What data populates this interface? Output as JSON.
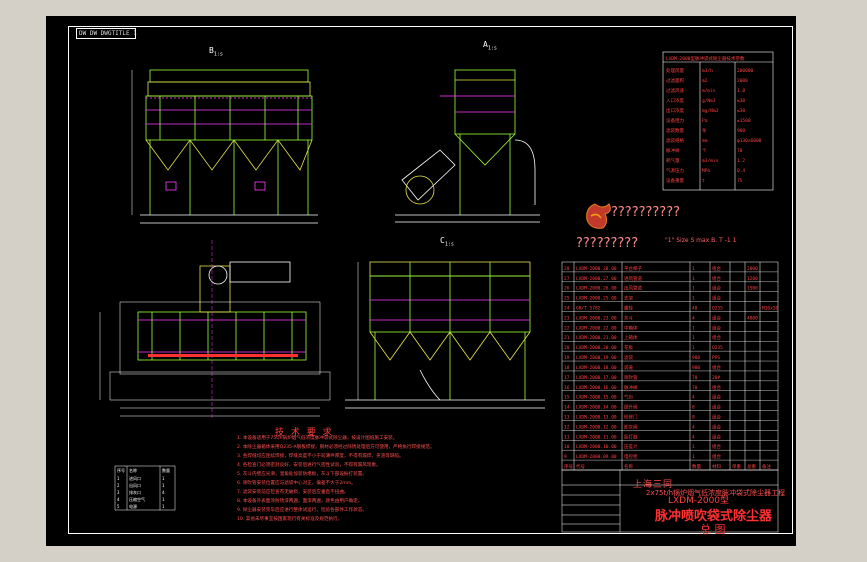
{
  "drawing": {
    "stamp": "DW DW DWGTITLE 1",
    "views": {
      "b_label": "B",
      "a_label": "A",
      "c_label": "C",
      "view_suffix": "1:s"
    },
    "logo_caption": "??????????",
    "subtitle": "?????????",
    "ratio_text": "\"1\" Size  S  max  B. T  -1  1",
    "title_block": {
      "project_name": "上海三同",
      "project_line2": "2x75t/h锅炉烟气低浓度脉冲袋式除尘器工程",
      "model": "LXDM-2000型",
      "main_title": "脉冲喷吹袋式除尘器",
      "drawing_name": "总  图"
    },
    "notes_title": "技 术 要 求",
    "notes": [
      "1. 本设备适用于75t/h锅炉烟气低浓度脉冲袋式除尘器，按设计图纸施工安装。",
      "2. 本除尘器箱体采用Q235-A钢板焊接，钢材必须经过除锈处理后方可使用，严格执行焊接规范。",
      "3. 各焊缝均应连续焊接，焊缝高度不小于较薄件厚度，不得有漏焊、夹渣等缺陷。",
      "4. 各检查门必须密封良好，安装后进行气密性试验，不得有漏风现象。",
      "5. 灰斗内壁应光滑，溜角处加装防堵板，灰斗下部设振打装置。",
      "6. 喷吹管安装位置应与滤袋中心对正，偏差不大于2mm。",
      "7. 滤袋安装前应检查有无破损，安装后应垂直不扭曲。",
      "8. 本设备外表面涂防锈漆两遍，面漆两遍，颜色由用户确定。",
      "9. 除尘器安装完毕后应进行整体试运行，检验各部件工作状态。",
      "10. 其他未尽事宜按国家现行有关标准及规范执行。"
    ],
    "parts_table": {
      "headers": [
        "序号",
        "代号",
        "名称",
        "数量",
        "材料",
        "单重",
        "总重",
        "备注"
      ],
      "rows": [
        [
          "28",
          "LXDM-2000.28.00",
          "平台梯子",
          "1",
          "组合",
          "",
          "2000",
          ""
        ],
        [
          "27",
          "LXDM-2000.27.00",
          "进风管道",
          "1",
          "组合",
          "",
          "1200",
          ""
        ],
        [
          "26",
          "LXDM-2000.26.00",
          "出风管道",
          "1",
          "组合",
          "",
          "1500",
          ""
        ],
        [
          "25",
          "LXDM-2000.25.00",
          "支架",
          "1",
          "组合",
          "",
          "",
          ""
        ],
        [
          "24",
          "GB/T 5782",
          "螺栓",
          "48",
          "Q235",
          "",
          "",
          "M16x50"
        ],
        [
          "23",
          "LXDM-2000.23.00",
          "灰斗",
          "4",
          "组合",
          "",
          "4800",
          ""
        ],
        [
          "22",
          "LXDM-2000.22.00",
          "中箱体",
          "1",
          "组合",
          "",
          "",
          ""
        ],
        [
          "21",
          "LXDM-2000.21.00",
          "上箱体",
          "1",
          "组合",
          "",
          "",
          ""
        ],
        [
          "20",
          "LXDM-2000.20.00",
          "花板",
          "1",
          "Q235",
          "",
          "",
          ""
        ],
        [
          "19",
          "LXDM-2000.19.00",
          "滤袋",
          "980",
          "PPS",
          "",
          "",
          ""
        ],
        [
          "18",
          "LXDM-2000.18.00",
          "袋笼",
          "980",
          "组合",
          "",
          "",
          ""
        ],
        [
          "17",
          "LXDM-2000.17.00",
          "喷吹管",
          "70",
          "20#",
          "",
          "",
          ""
        ],
        [
          "16",
          "LXDM-2000.16.00",
          "脉冲阀",
          "70",
          "组合",
          "",
          "",
          ""
        ],
        [
          "15",
          "LXDM-2000.15.00",
          "气包",
          "4",
          "组合",
          "",
          "",
          ""
        ],
        [
          "14",
          "LXDM-2000.14.00",
          "提升阀",
          "8",
          "组合",
          "",
          "",
          ""
        ],
        [
          "13",
          "LXDM-2000.13.00",
          "检修门",
          "8",
          "组合",
          "",
          "",
          ""
        ],
        [
          "12",
          "LXDM-2000.12.00",
          "卸灰阀",
          "4",
          "组合",
          "",
          "",
          ""
        ],
        [
          "11",
          "LXDM-2000.11.00",
          "振打器",
          "4",
          "组合",
          "",
          "",
          ""
        ],
        [
          "10",
          "LXDM-2000.10.00",
          "压差计",
          "1",
          "组合",
          "",
          "",
          ""
        ],
        [
          "9",
          "LXDM-2000.09.00",
          "电控柜",
          "1",
          "组合",
          "",
          "",
          ""
        ]
      ]
    },
    "small_table": {
      "headers": [
        "序号",
        "名称",
        "数量"
      ],
      "rows": [
        [
          "1",
          "进风口",
          "1"
        ],
        [
          "2",
          "出风口",
          "1"
        ],
        [
          "3",
          "排灰口",
          "4"
        ],
        [
          "4",
          "压缩空气",
          "1"
        ],
        [
          "5",
          "电源",
          "1"
        ]
      ]
    },
    "top_right_table": {
      "header": "LXDM-2000型脉冲袋式除尘器技术参数",
      "rows": [
        [
          "处理风量",
          "m3/h",
          "200000"
        ],
        [
          "过滤面积",
          "m2",
          "2000"
        ],
        [
          "过滤风速",
          "m/min",
          "1.0"
        ],
        [
          "入口浓度",
          "g/Nm3",
          "≤30"
        ],
        [
          "出口浓度",
          "mg/Nm3",
          "≤30"
        ],
        [
          "设备阻力",
          "Pa",
          "≤1500"
        ],
        [
          "滤袋数量",
          "条",
          "980"
        ],
        [
          "滤袋规格",
          "mm",
          "φ130x6000"
        ],
        [
          "脉冲阀",
          "个",
          "70"
        ],
        [
          "耗气量",
          "m3/min",
          "1.2"
        ],
        [
          "气源压力",
          "MPa",
          "0.4"
        ],
        [
          "设备重量",
          "t",
          "75"
        ]
      ]
    },
    "colors": {
      "background": "#000000",
      "line_green": "#9cff3a",
      "line_yellow": "#e8e24a",
      "line_magenta": "#ff3cff",
      "line_white": "#ffffff",
      "text_red": "#ff4040",
      "window": "#d4d0c8"
    }
  }
}
